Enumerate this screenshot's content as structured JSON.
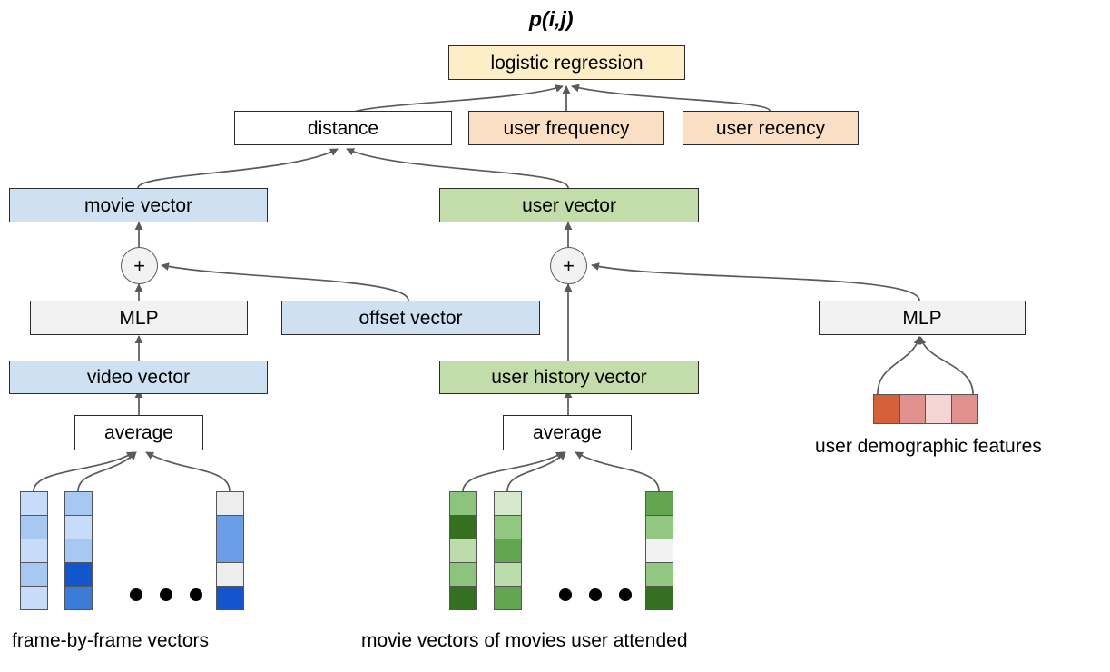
{
  "diagram": {
    "title_formula": "p(i,j)",
    "colors": {
      "logistic": "#fdeec8",
      "user_feature": "#fbdfc4",
      "blue_box": "#cfe0f3",
      "green_box": "#c3ddaa",
      "gray_box": "#f2f2f2",
      "white_box": "#ffffff",
      "edge": "#5a5a5a",
      "border": "#2b2b2b"
    },
    "nodes": {
      "logistic_regression": "logistic regression",
      "distance": "distance",
      "user_frequency": "user frequency",
      "user_recency": "user recency",
      "movie_vector": "movie vector",
      "user_vector": "user vector",
      "plus_left": "+",
      "plus_right": "+",
      "mlp_left": "MLP",
      "mlp_right": "MLP",
      "offset_vector": "offset vector",
      "video_vector": "video vector",
      "user_history_vector": "user history vector",
      "average_left": "average",
      "average_right": "average"
    },
    "captions": {
      "frame_vectors": "frame-by-frame vectors",
      "movie_vectors": "movie vectors of movies user attended",
      "demographic": "user demographic features"
    },
    "vectors": {
      "frame_columns": [
        {
          "name": "frame-vector-1",
          "cells": [
            "#c7dcf8",
            "#a6c8f3",
            "#c7dcf8",
            "#a6c8f3",
            "#c7dcf8"
          ]
        },
        {
          "name": "frame-vector-2",
          "cells": [
            "#a6c8f3",
            "#c7dcf8",
            "#a6c8f3",
            "#1255cc",
            "#3b7cd8"
          ]
        },
        {
          "name": "frame-vector-n",
          "cells": [
            "#ededed",
            "#6a9fe8",
            "#6a9fe8",
            "#ededed",
            "#1255cc"
          ]
        }
      ],
      "movie_columns": [
        {
          "name": "movie-vector-1",
          "cells": [
            "#8cc47e",
            "#34701f",
            "#bcdcab",
            "#8cc47e",
            "#34701f"
          ]
        },
        {
          "name": "movie-vector-2",
          "cells": [
            "#d7e9cc",
            "#93c883",
            "#63a64f",
            "#bcdcab",
            "#63a64f"
          ]
        },
        {
          "name": "movie-vector-n",
          "cells": [
            "#63a64f",
            "#93c883",
            "#f2f2f2",
            "#93c883",
            "#34701f"
          ]
        }
      ],
      "demographic_row": {
        "name": "demographic-feature-row",
        "cells": [
          "#d4613a",
          "#e0918e",
          "#f5d5d4",
          "#e0918e"
        ]
      }
    }
  }
}
